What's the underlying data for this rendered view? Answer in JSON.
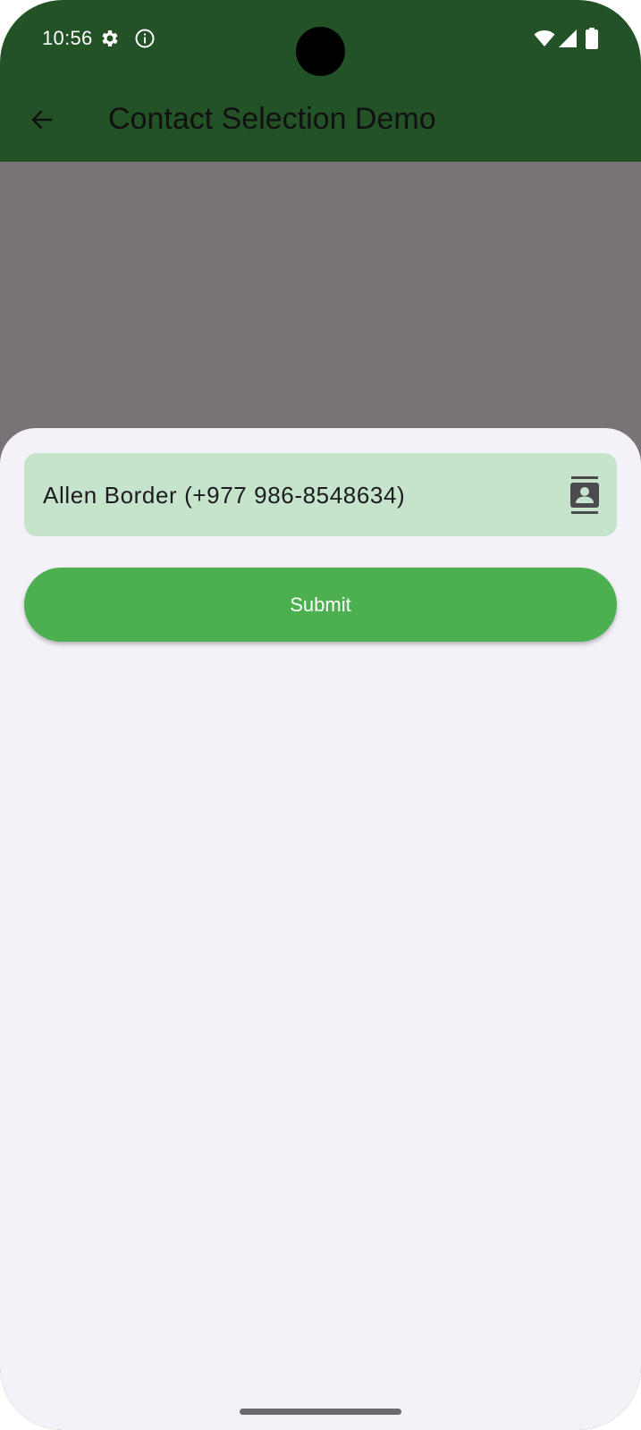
{
  "status_bar": {
    "time": "10:56",
    "left_icons": [
      "gear-icon",
      "info-icon"
    ],
    "right_icons": [
      "wifi-icon",
      "cellular-signal-icon",
      "battery-icon"
    ]
  },
  "app_bar": {
    "title": "Contact Selection Demo",
    "back_icon": "arrow-back-icon",
    "background_color": "#235226"
  },
  "bottom_sheet": {
    "contact_field": {
      "value": "Allen Border (+977 986-8548634)",
      "icon": "contacts-icon",
      "background_color": "#c6e4cc"
    },
    "submit_label": "Submit",
    "submit_color": "#4caf50",
    "background_color": "#f4f1f8"
  },
  "scrim_color": "#797276"
}
